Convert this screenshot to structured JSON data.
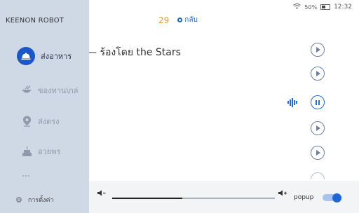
{
  "status": {
    "battery": "50%",
    "time": "12:32"
  },
  "header": {
    "count": "29",
    "back_label": "กลับ"
  },
  "now_playing_title": "— ร้องโดย the Stars",
  "tracks": [
    {
      "state": "play"
    },
    {
      "state": "play"
    },
    {
      "state": "playing"
    },
    {
      "state": "play"
    },
    {
      "state": "play"
    }
  ],
  "sidebar": {
    "brand": "KEENON ROBOT",
    "items": [
      {
        "label": "ส่งอาหาร",
        "icon": "cloche-icon",
        "active": true
      },
      {
        "label": "ของทาน\\กล่",
        "icon": "bowl-icon",
        "active": false
      },
      {
        "label": "ส่งตรง",
        "icon": "location-pin-icon",
        "active": false
      },
      {
        "label": "อวยพร",
        "icon": "cake-icon",
        "active": false
      },
      {
        "label": "",
        "icon": "grid-icon",
        "active": false
      }
    ],
    "settings_label": "การตั้งค่า"
  },
  "bottombar": {
    "volume_level": 0.43,
    "popup_label": "popup",
    "popup_enabled": true
  },
  "colors": {
    "accent": "#1e66d8",
    "count": "#f39a27",
    "sidebar_bg": "#cfd8e5"
  }
}
